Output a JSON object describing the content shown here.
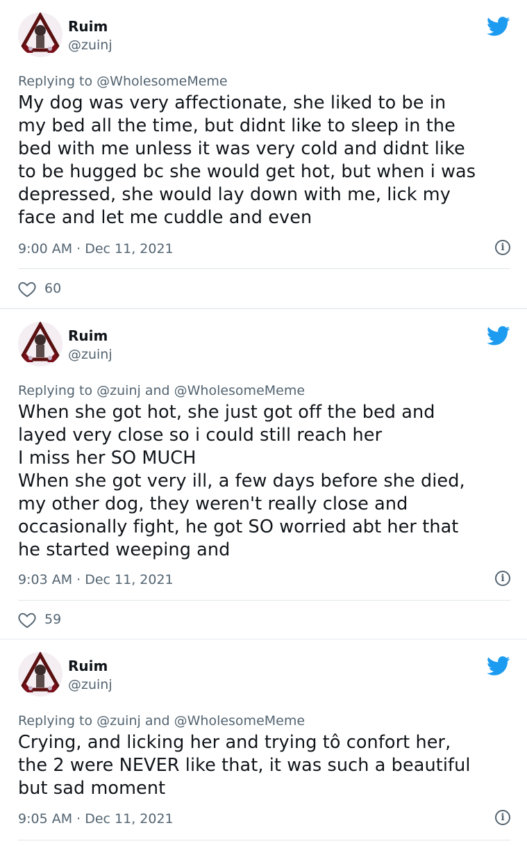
{
  "colors": {
    "text": "#0f1419",
    "secondary": "#536471",
    "twitter_blue": "#1d9bf0",
    "divider": "#e6ecf0"
  },
  "tweets": [
    {
      "name": "Ruim",
      "handle": "@zuinj",
      "replying_prefix": "Replying to",
      "replying_to": "@WholesomeMeme",
      "text": "My dog was very affectionate, she liked to be in\nmy bed all the time, but didnt like to sleep in the\nbed with me unless it was very cold and didnt like\nto be hugged bc she would get hot, but when i was\ndepressed, she would lay down with me, lick my\nface and let me cuddle and even",
      "timestamp": "9:00 AM · Dec 11, 2021",
      "likes": "60"
    },
    {
      "name": "Ruim",
      "handle": "@zuinj",
      "replying_prefix": "Replying to",
      "replying_to": "@zuinj and @WholesomeMeme",
      "text": "When she got hot, she just got off the bed and\nlayed very close so i could still reach her\nI miss her SO MUCH\nWhen she got very ill, a few days before she died,\nmy other dog, they weren't really close and\noccasionally fight, he got SO worried abt her that\nhe started weeping and",
      "timestamp": "9:03 AM · Dec 11, 2021",
      "likes": "59"
    },
    {
      "name": "Ruim",
      "handle": "@zuinj",
      "replying_prefix": "Replying to",
      "replying_to": "@zuinj and @WholesomeMeme",
      "text": "Crying, and licking her and trying tô confort her,\nthe 2 were NEVER like that, it was such a beautiful\nbut sad moment",
      "timestamp": "9:05 AM · Dec 11, 2021"
    }
  ],
  "icons": {
    "logo": "twitter-bird-icon",
    "info": "info-icon",
    "like": "heart-icon"
  }
}
